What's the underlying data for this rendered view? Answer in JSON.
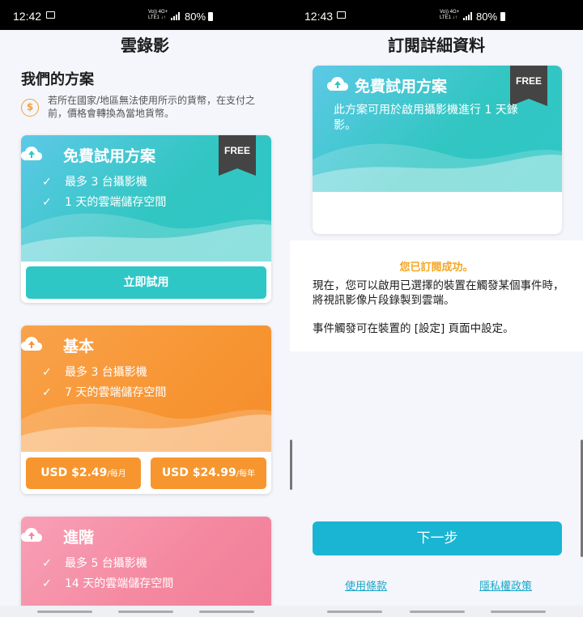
{
  "left_screen": {
    "status": {
      "time": "12:42",
      "network": "Vo)) 4G+\nLTE1 ↓↑",
      "battery": "80%"
    },
    "title": "雲錄影",
    "plans_heading": "我們的方案",
    "currency_note": "若所在國家/地區無法使用所示的貨幣，在支付之前，價格會轉換為當地貨幣。",
    "coin_symbol": "$",
    "plans": [
      {
        "name": "免費試用方案",
        "badge": "FREE",
        "features": [
          "最多 3 台攝影機",
          "1 天的雲端儲存空間"
        ],
        "button": "立即試用",
        "color": "#2ec7c6"
      },
      {
        "name": "基本",
        "features": [
          "最多 3 台攝影機",
          "7 天的雲端儲存空間"
        ],
        "monthly_price": "USD $2.49",
        "monthly_unit": "/每月",
        "yearly_price": "USD $24.99",
        "yearly_unit": "/每年",
        "color": "#f7962e"
      },
      {
        "name": "進階",
        "features": [
          "最多 5 台攝影機",
          "14 天的雲端儲存空間"
        ],
        "color": "#f3849e"
      }
    ]
  },
  "right_screen": {
    "status": {
      "time": "12:43",
      "network": "Vo)) 4G+\nLTE1 ↓↑",
      "battery": "80%"
    },
    "title": "訂閱詳細資料",
    "plan_name": "免費試用方案",
    "badge": "FREE",
    "plan_description": "此方案可用於啟用攝影機進行 1 天錄影。",
    "success_title": "您已訂閱成功。",
    "success_body": "現在，您可以啟用已選擇的裝置在觸發某個事件時，將視訊影像片段錄製到雲端。",
    "success_body2": "事件觸發可在裝置的 [設定] 頁面中設定。",
    "next_button": "下一步",
    "terms_link": "使用條款",
    "privacy_link": "隱私權政策"
  },
  "icons": [
    "message-icon",
    "signal-icon",
    "battery-icon",
    "cloud-upload-icon",
    "check-icon",
    "coin-icon"
  ],
  "colors": {
    "teal": "#2ec7c6",
    "orange": "#f7962e",
    "pink": "#f3849e",
    "accent_blue": "#1ab5d3",
    "success_orange": "#f5a623"
  }
}
